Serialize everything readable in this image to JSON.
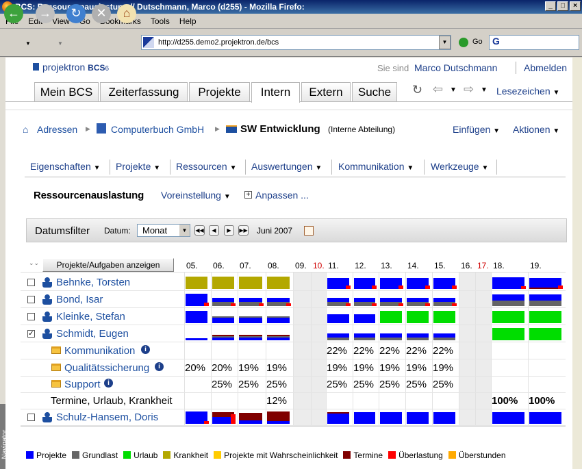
{
  "window": {
    "title": "BCS: Ressourcenauslastung // Dutschmann, Marco (d255) - Mozilla Firefo:",
    "min": "_",
    "max": "□",
    "close": "×"
  },
  "menubar": [
    "File",
    "Edit",
    "View",
    "Go",
    "Bookmarks",
    "Tools",
    "Help"
  ],
  "browser": {
    "url": "http://d255.demo2.projektron.de/bcs",
    "go_label": "Go",
    "search_value": "G"
  },
  "app": {
    "logo": "projektron",
    "logo_suffix": "BCS",
    "logo_version": "6",
    "user_prefix": "Sie sind",
    "user_name": "Marco Dutschmann",
    "logout": "Abmelden",
    "bookmarks": "Lesezeichen"
  },
  "tabs": [
    {
      "label": "Mein BCS"
    },
    {
      "label": "Zeiterfassung"
    },
    {
      "label": "Projekte"
    },
    {
      "label": "Intern"
    },
    {
      "label": "Extern"
    },
    {
      "label": "Suche"
    }
  ],
  "breadcrumb": [
    {
      "label": "Adressen"
    },
    {
      "label": "Computerbuch GmbH"
    },
    {
      "label": "SW Entwicklung"
    }
  ],
  "breadcrumb_note": "(Interne Abteilung)",
  "actions": {
    "insert": "Einfügen",
    "actions": "Aktionen"
  },
  "submenu": [
    "Eigenschaften",
    "Projekte",
    "Ressourcen",
    "Auswertungen",
    "Kommunikation",
    "Werkzeuge"
  ],
  "view": {
    "title": "Ressourcenauslastung",
    "preset": "Voreinstellung",
    "customize": "Anpassen ..."
  },
  "filter": {
    "title": "Datumsfilter",
    "date_label": "Datum:",
    "period": "Monat",
    "month": "Juni 2007"
  },
  "grid": {
    "show_button": "Projekte/Aufgaben anzeigen",
    "days": [
      "05.",
      "06.",
      "07.",
      "08.",
      "09.",
      "10.",
      "11.",
      "12.",
      "13.",
      "14.",
      "15.",
      "16.",
      "17.",
      "18.",
      "19."
    ],
    "people": [
      "Behnke, Torsten",
      "Bond, Isar",
      "Kleinke, Stefan",
      "Schmidt, Eugen"
    ],
    "sub_items": [
      "Kommunikation",
      "Qualitätssicherung",
      "Support"
    ],
    "other_row": "Termine, Urlaub, Krankheit",
    "last_person": "Schulz-Hansem, Doris",
    "kom_pct": [
      "22%",
      "22%",
      "22%",
      "22%",
      "22%"
    ],
    "qs_pct": [
      "20%",
      "20%",
      "19%",
      "19%",
      "19%",
      "19%",
      "19%",
      "19%",
      "19%"
    ],
    "sup_pct": [
      "25%",
      "25%",
      "25%",
      "25%",
      "25%",
      "25%",
      "25%",
      "25%"
    ],
    "other_pct": [
      "12%",
      "100%",
      "100%"
    ]
  },
  "legend": [
    {
      "label": "Projekte",
      "color": "#0000ff"
    },
    {
      "label": "Grundlast",
      "color": "#666666"
    },
    {
      "label": "Urlaub",
      "color": "#00dd00"
    },
    {
      "label": "Krankheit",
      "color": "#b3a800"
    },
    {
      "label": "Projekte mit Wahrscheinlichkeit",
      "color": "#ffcc00"
    },
    {
      "label": "Termine",
      "color": "#800000"
    },
    {
      "label": "Überlastung",
      "color": "#ff0000"
    },
    {
      "label": "Überstunden",
      "color": "#ffaa00"
    }
  ],
  "sidebar_label": "Navigator"
}
